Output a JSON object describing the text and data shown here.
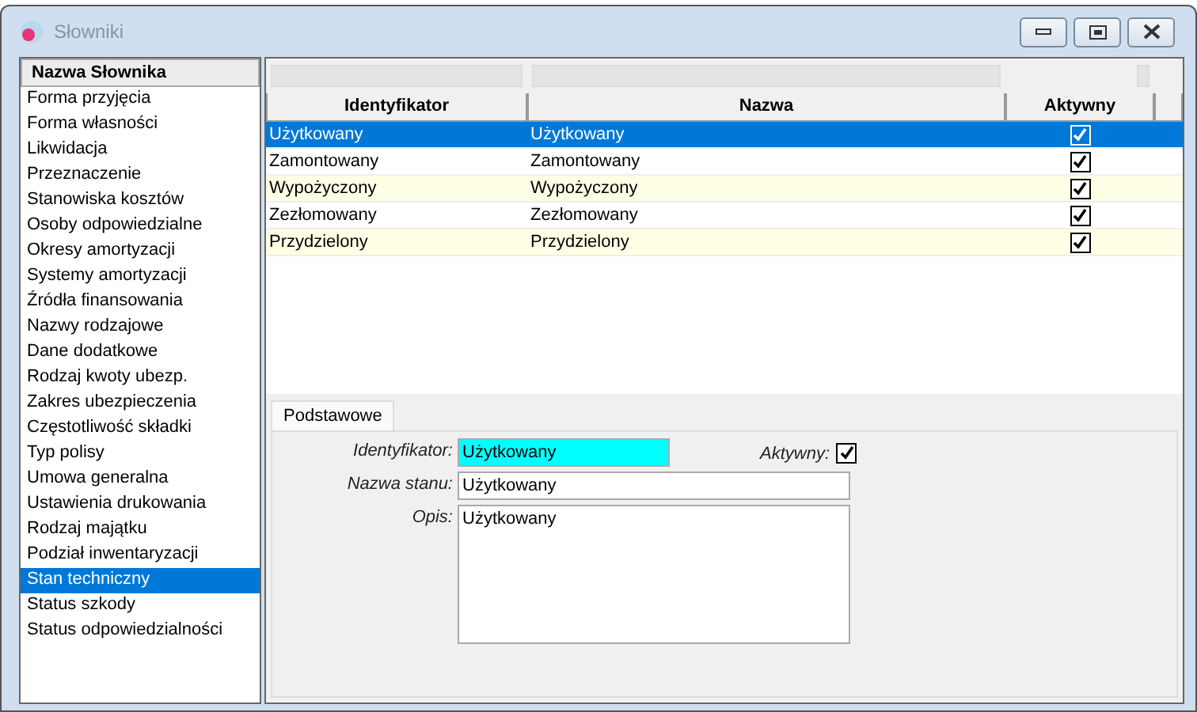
{
  "window": {
    "title": "Słowniki"
  },
  "sidebar": {
    "header": "Nazwa Słownika",
    "items": [
      {
        "label": "Forma przyjęcia",
        "selected": false
      },
      {
        "label": "Forma własności",
        "selected": false
      },
      {
        "label": "Likwidacja",
        "selected": false
      },
      {
        "label": "Przeznaczenie",
        "selected": false
      },
      {
        "label": "Stanowiska kosztów",
        "selected": false
      },
      {
        "label": "Osoby odpowiedzialne",
        "selected": false
      },
      {
        "label": "Okresy amortyzacji",
        "selected": false
      },
      {
        "label": "Systemy amortyzacji",
        "selected": false
      },
      {
        "label": "Źródła finansowania",
        "selected": false
      },
      {
        "label": "Nazwy rodzajowe",
        "selected": false
      },
      {
        "label": "Dane dodatkowe",
        "selected": false
      },
      {
        "label": "Rodzaj kwoty ubezp.",
        "selected": false
      },
      {
        "label": "Zakres ubezpieczenia",
        "selected": false
      },
      {
        "label": "Częstotliwość składki",
        "selected": false
      },
      {
        "label": "Typ polisy",
        "selected": false
      },
      {
        "label": "Umowa generalna",
        "selected": false
      },
      {
        "label": "Ustawienia drukowania",
        "selected": false
      },
      {
        "label": "Rodzaj majątku",
        "selected": false
      },
      {
        "label": "Podział inwentaryzacji",
        "selected": false
      },
      {
        "label": "Stan techniczny",
        "selected": true
      },
      {
        "label": "Status szkody",
        "selected": false
      },
      {
        "label": "Status odpowiedzialności",
        "selected": false
      }
    ]
  },
  "table": {
    "columns": [
      "Identyfikator",
      "Nazwa",
      "Aktywny"
    ],
    "rows": [
      {
        "id": "Użytkowany",
        "name": "Użytkowany",
        "active": true,
        "selected": true
      },
      {
        "id": "Zamontowany",
        "name": "Zamontowany",
        "active": true,
        "selected": false
      },
      {
        "id": "Wypożyczony",
        "name": "Wypożyczony",
        "active": true,
        "selected": false
      },
      {
        "id": "Zezłomowany",
        "name": "Zezłomowany",
        "active": true,
        "selected": false
      },
      {
        "id": "Przydzielony",
        "name": "Przydzielony",
        "active": true,
        "selected": false
      }
    ]
  },
  "tabs": [
    {
      "label": "Podstawowe",
      "selected": true
    }
  ],
  "form": {
    "id_label": "Identyfikator:",
    "id_value": "Użytkowany",
    "active_label": "Aktywny:",
    "active": true,
    "name_label": "Nazwa stanu:",
    "name_value": "Użytkowany",
    "desc_label": "Opis:",
    "desc_value": "Użytkowany"
  }
}
